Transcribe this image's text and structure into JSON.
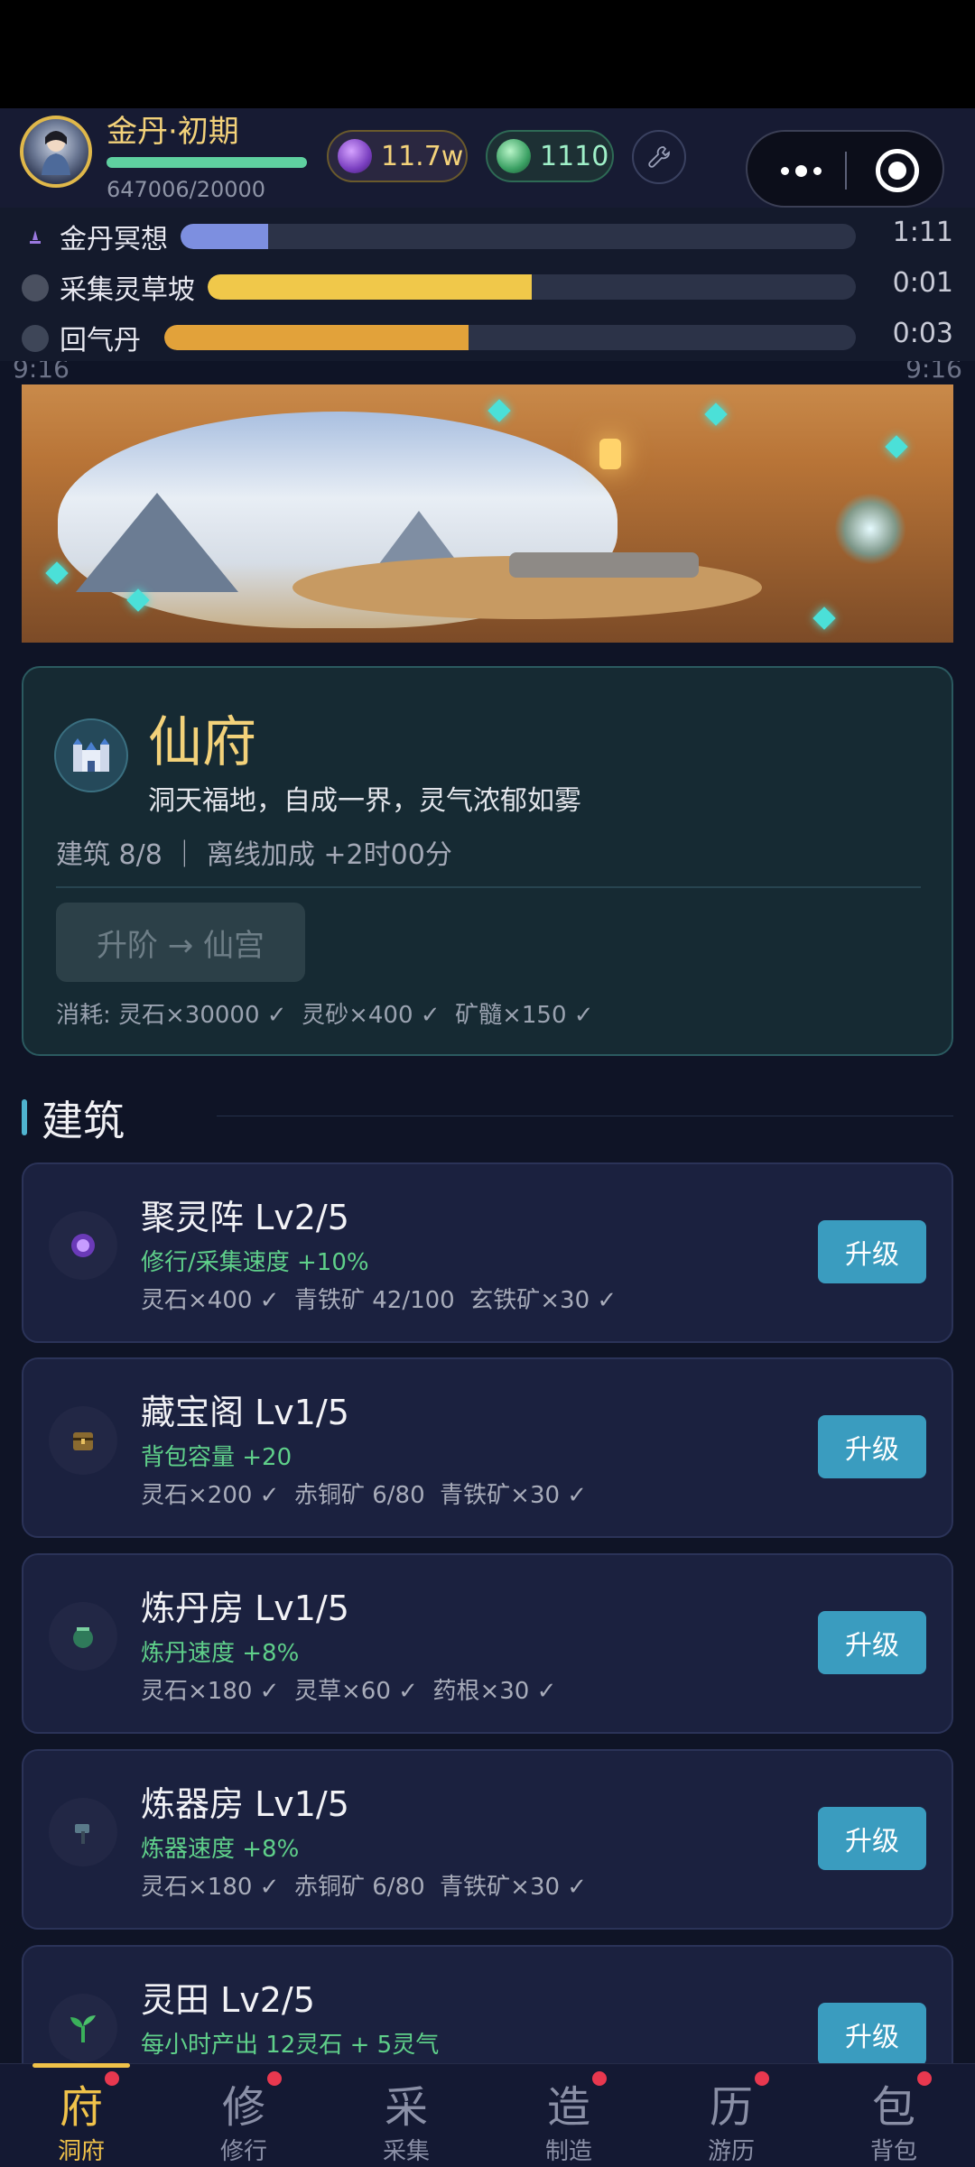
{
  "player": {
    "realm": "金丹·初期",
    "xp_text": "647006/20000",
    "xp_fraction": 1.0
  },
  "currencies": {
    "spirit_stone": "11.7w",
    "spirit_herb": "1110"
  },
  "tasks": [
    {
      "label": "金丹冥想",
      "time": "1:11",
      "progress": 0.13,
      "color": "#7d8fe0",
      "icon": "meditation-icon"
    },
    {
      "label": "采集灵草坡",
      "time": "0:01",
      "progress": 0.5,
      "color": "#f0c84a",
      "icon": "gather-icon"
    },
    {
      "label": "回气丹",
      "time": "0:03",
      "progress": 0.44,
      "color": "#e2a23a",
      "icon": "pill-icon"
    }
  ],
  "mid_status": {
    "left": "9:16",
    "right": "9:16"
  },
  "estate": {
    "title": "仙府",
    "description": "洞天福地，自成一界，灵气浓郁如雾",
    "stats": "建筑 8/8 ｜ 离线加成 +2时00分",
    "ascend_button": "升阶 → 仙宫",
    "cost": "消耗: 灵石×30000 ✓  灵砂×400 ✓  矿髓×150 ✓"
  },
  "section": {
    "title": "建筑"
  },
  "buildings": [
    {
      "name": "聚灵阵  Lv2/5",
      "effect": "修行/采集速度 +10%",
      "cost": "灵石×400 ✓  青铁矿 42/100  玄铁矿×30 ✓",
      "button": "升级",
      "icon_color": "#8a55d8"
    },
    {
      "name": "藏宝阁  Lv1/5",
      "effect": "背包容量 +20",
      "cost": "灵石×200 ✓  赤铜矿 6/80  青铁矿×30 ✓",
      "button": "升级",
      "icon_color": "#9a7a3a"
    },
    {
      "name": "炼丹房  Lv1/5",
      "effect": "炼丹速度 +8%",
      "cost": "灵石×180 ✓  灵草×60 ✓  药根×30 ✓",
      "button": "升级",
      "icon_color": "#3aa07a"
    },
    {
      "name": "炼器房  Lv1/5",
      "effect": "炼器速度 +8%",
      "cost": "灵石×180 ✓  赤铜矿 6/80  青铁矿×30 ✓",
      "button": "升级",
      "icon_color": "#4a6a7a"
    },
    {
      "name": "灵田  Lv2/5",
      "effect": "每小时产出 12灵石 + 5灵气",
      "cost": "",
      "button": "升级",
      "icon_color": "#3aa05a"
    }
  ],
  "tabs": [
    {
      "glyph": "府",
      "label": "洞府",
      "active": true,
      "dot": true
    },
    {
      "glyph": "修",
      "label": "修行",
      "active": false,
      "dot": true
    },
    {
      "glyph": "采",
      "label": "采集",
      "active": false,
      "dot": false
    },
    {
      "glyph": "造",
      "label": "制造",
      "active": false,
      "dot": true
    },
    {
      "glyph": "历",
      "label": "游历",
      "active": false,
      "dot": true
    },
    {
      "glyph": "包",
      "label": "背包",
      "active": false,
      "dot": true
    }
  ]
}
